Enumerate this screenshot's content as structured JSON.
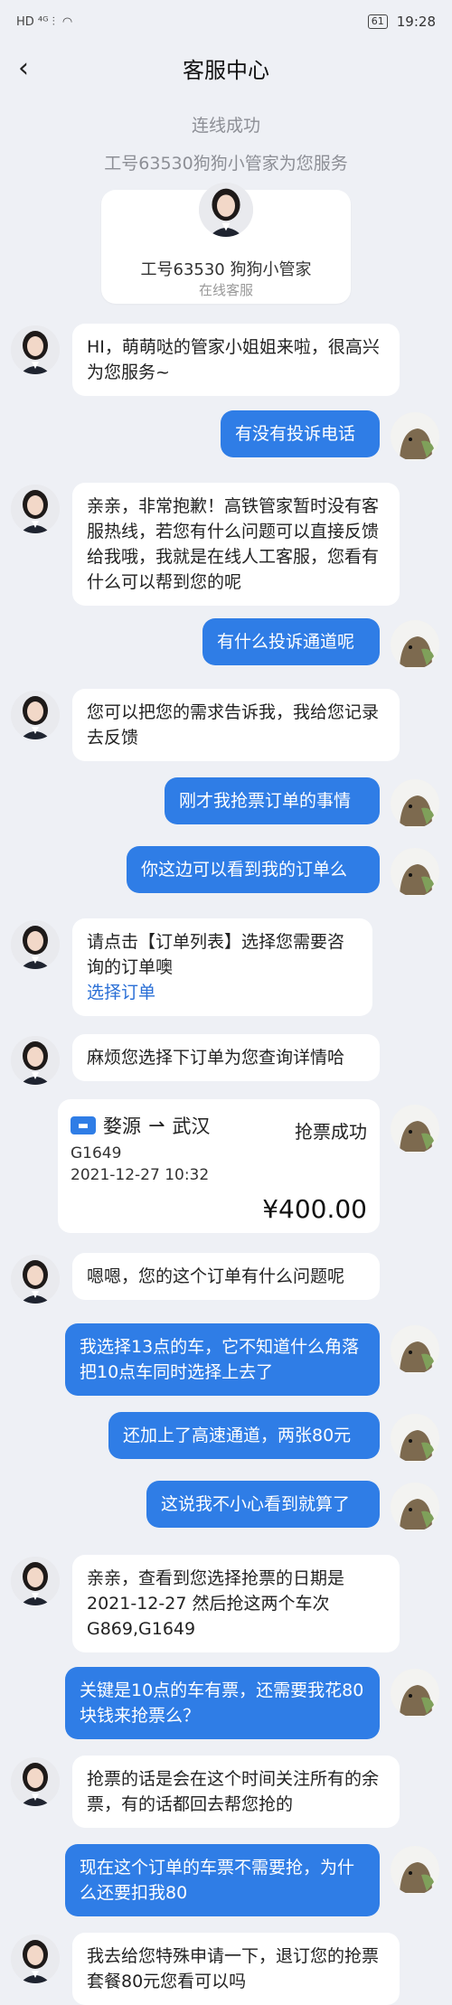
{
  "status_bar": {
    "left_icons": "HD ⁴ᴳ ⫶",
    "battery": "61",
    "time": "19:28"
  },
  "nav": {
    "title": "客服中心"
  },
  "system": {
    "connected": "连线成功",
    "service_notice": "工号63530狗狗小管家为您服务"
  },
  "agent_card": {
    "name": "工号63530 狗狗小管家",
    "status": "在线客服"
  },
  "messages": [
    {
      "from": "agent",
      "text": "HI，萌萌哒的管家小姐姐来啦，很高兴为您服务~"
    },
    {
      "from": "user",
      "text": "有没有投诉电话"
    },
    {
      "from": "agent",
      "text": "亲亲，非常抱歉！高铁管家暂时没有客服热线，若您有什么问题可以直接反馈给我哦，我就是在线人工客服，您看有什么可以帮到您的呢"
    },
    {
      "from": "user",
      "text": "有什么投诉通道呢"
    },
    {
      "from": "agent",
      "text": "您可以把您的需求告诉我，我给您记录去反馈"
    },
    {
      "from": "user",
      "text": "刚才我抢票订单的事情"
    },
    {
      "from": "user",
      "text": "你这边可以看到我的订单么"
    },
    {
      "from": "agent",
      "text": "请点击【订单列表】选择您需要咨询的订单噢",
      "link": "选择订单"
    },
    {
      "from": "agent",
      "text": "麻烦您选择下订单为您查询详情哈"
    },
    {
      "from": "agent",
      "text": "嗯嗯，您的这个订单有什么问题呢"
    },
    {
      "from": "user",
      "text": "我选择13点的车，它不知道什么角落把10点车同时选择上去了"
    },
    {
      "from": "user",
      "text": "还加上了高速通道，两张80元"
    },
    {
      "from": "user",
      "text": "这说我不小心看到就算了"
    },
    {
      "from": "agent",
      "text": "亲亲，查看到您选择抢票的日期是2021-12-27 然后抢这两个车次G869,G1649"
    },
    {
      "from": "user",
      "text": "关键是10点的车有票，还需要我花80块钱来抢票么？"
    },
    {
      "from": "agent",
      "text": "抢票的话是会在这个时间关注所有的余票，有的话都回去帮您抢的"
    },
    {
      "from": "user",
      "text": "现在这个订单的车票不需要抢，为什么还要扣我80"
    },
    {
      "from": "agent",
      "text": "我去给您特殊申请一下，退订您的抢票套餐80元您看可以吗"
    }
  ],
  "order": {
    "from_station": "婺源",
    "to_station": "武汉",
    "status": "抢票成功",
    "train": "G1649",
    "datetime": "2021-12-27 10:32",
    "price": "¥400.00"
  }
}
